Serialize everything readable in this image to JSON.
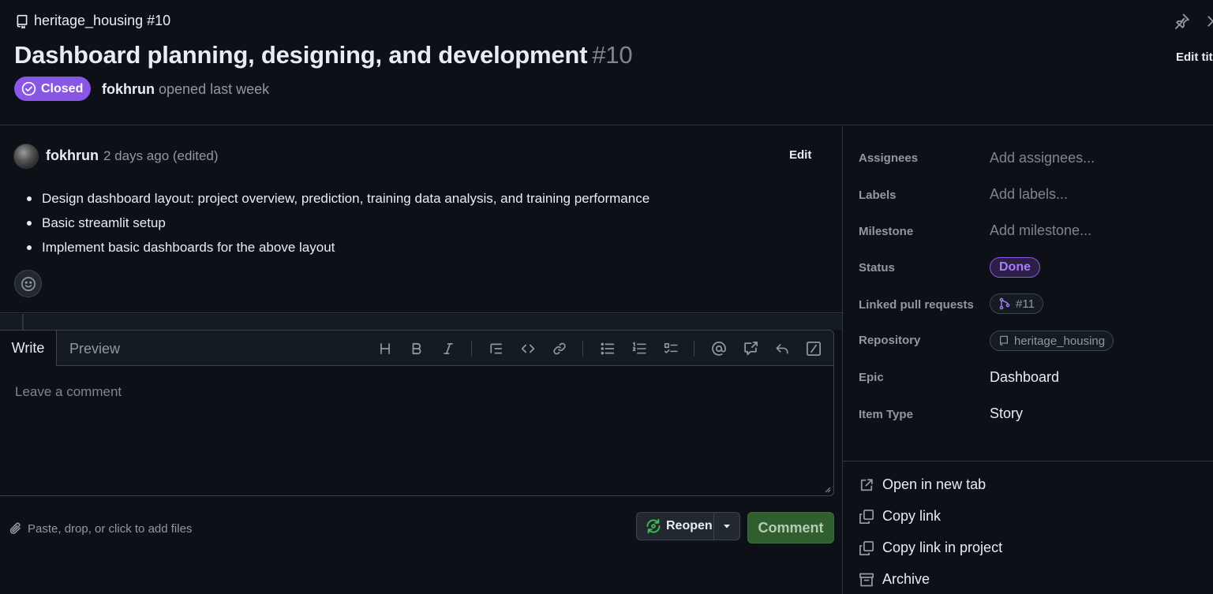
{
  "header": {
    "repo_ref": "heritage_housing #10",
    "title": "Dashboard planning, designing, and development",
    "number": "#10",
    "state": "Closed",
    "author": "fokhrun",
    "opened_text": "opened last week",
    "edit_title_label": "Edit title"
  },
  "comment": {
    "author": "fokhrun",
    "timestamp": "2 days ago (edited)",
    "edit_label": "Edit",
    "body": [
      "Design dashboard layout: project overview, prediction, training data analysis, and training performance",
      "Basic streamlit setup",
      "Implement basic dashboards for the above layout"
    ]
  },
  "editor": {
    "tab_write": "Write",
    "tab_preview": "Preview",
    "placeholder": "Leave a comment",
    "toolbar": [
      "heading-icon",
      "bold-icon",
      "italic-icon",
      "quote-icon",
      "code-icon",
      "link-icon",
      "unordered-list-icon",
      "ordered-list-icon",
      "task-list-icon",
      "mention-icon",
      "reference-icon",
      "reply-icon",
      "slash-command-icon"
    ],
    "attach_text": "Paste, drop, or click to add files",
    "reopen_label": "Reopen",
    "comment_label": "Comment"
  },
  "sidebar": {
    "fields": {
      "assignees": {
        "label": "Assignees",
        "value": "Add assignees..."
      },
      "labels": {
        "label": "Labels",
        "value": "Add labels..."
      },
      "milestone": {
        "label": "Milestone",
        "value": "Add milestone..."
      },
      "status": {
        "label": "Status",
        "value": "Done"
      },
      "linked_prs": {
        "label": "Linked pull requests",
        "value": "#11"
      },
      "repository": {
        "label": "Repository",
        "value": "heritage_housing"
      },
      "epic": {
        "label": "Epic",
        "value": "Dashboard"
      },
      "item_type": {
        "label": "Item Type",
        "value": "Story"
      }
    },
    "actions": {
      "open_new_tab": "Open in new tab",
      "copy_link": "Copy link",
      "copy_link_project": "Copy link in project",
      "archive": "Archive"
    }
  },
  "colors": {
    "background": "#0d1117",
    "closed_badge": "#8957e5",
    "status_done": "#ab7df8",
    "comment_button": "#2f5f2f"
  }
}
